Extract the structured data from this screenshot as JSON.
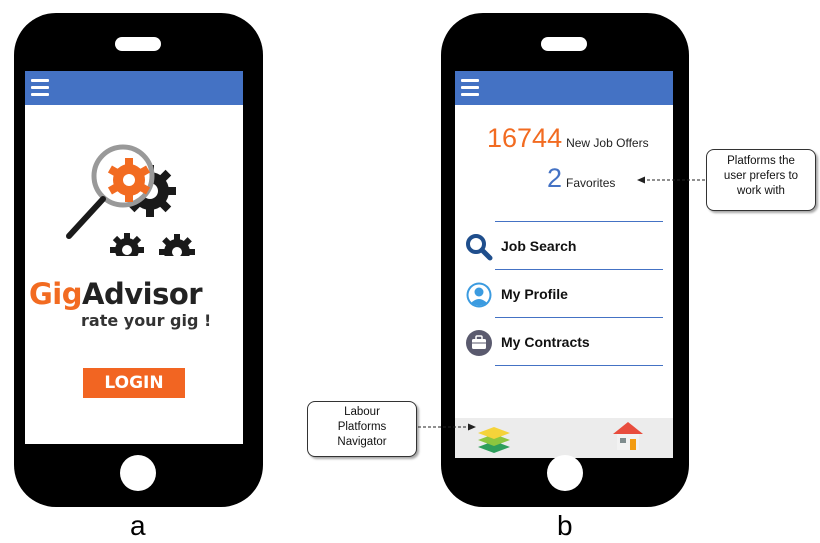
{
  "phone_a": {
    "caption": "a",
    "logo_gig": "Gig",
    "logo_advisor": "Advisor",
    "tagline": "rate your gig !",
    "login_label": "LOGIN",
    "colors": {
      "orange": "#f26522",
      "topbar": "#4472c4"
    }
  },
  "phone_b": {
    "caption": "b",
    "stats": {
      "offers_count": "16744",
      "offers_label": "New Job Offers",
      "favorites_count": "2",
      "favorites_label": "Favorites"
    },
    "menu": [
      {
        "label": "Job Search",
        "icon": "search-icon"
      },
      {
        "label": "My Profile",
        "icon": "user-icon"
      },
      {
        "label": "My Contracts",
        "icon": "briefcase-icon"
      }
    ],
    "bottom_bar": {
      "left_icon": "layers-icon",
      "right_icon": "home-icon"
    },
    "colors": {
      "orange": "#f26b21",
      "blue": "#4472c4"
    }
  },
  "callouts": {
    "favorites_note": [
      "Platforms the",
      "user prefers to",
      "work with"
    ],
    "navigator_note": [
      "Labour",
      "Platforms",
      "Navigator"
    ]
  }
}
